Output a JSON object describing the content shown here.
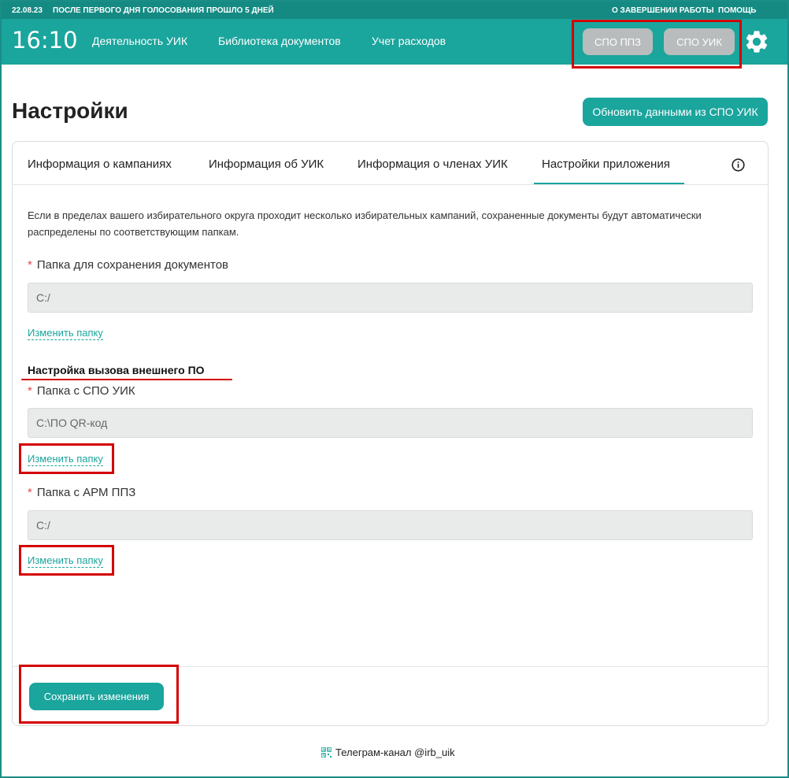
{
  "topbar": {
    "date": "22.08.23",
    "notice": "ПОСЛЕ ПЕРВОГО ДНЯ ГОЛОСОВАНИЯ ПРОШЛО 5 ДНЕЙ",
    "link_finish": "О ЗАВЕРШЕНИИ РАБОТЫ",
    "link_help": "ПОМОЩЬ"
  },
  "header": {
    "clock": "16:10",
    "nav": [
      "Деятельность УИК",
      "Библиотека документов",
      "Учет расходов"
    ],
    "pill_ppz": "СПО ППЗ",
    "pill_uik": "СПО УИК",
    "settings_icon": "gear-icon"
  },
  "page": {
    "title": "Настройки",
    "update_button": "Обновить данными из СПО УИК"
  },
  "tabs": [
    {
      "label": "Информация о кампаниях",
      "active": false
    },
    {
      "label": "Информация об УИК",
      "active": false
    },
    {
      "label": "Информация о членах УИК",
      "active": false
    },
    {
      "label": "Настройки приложения",
      "active": true
    }
  ],
  "settings": {
    "description": "Если в пределах вашего избирательного округа проходит несколько избирательных кампаний, сохраненные документы будут автоматически распределены по соответствующим папкам.",
    "docs_folder_label": "Папка для сохранения документов",
    "docs_folder_value": "C:/",
    "change_folder": "Изменить папку",
    "external_section_title": "Настройка вызова внешнего ПО",
    "spo_uik_label": "Папка с СПО УИК",
    "spo_uik_value": "C:\\ПО QR-код",
    "arm_ppz_label": "Папка с АРМ ППЗ",
    "arm_ppz_value": "C:/",
    "required_mark": "*"
  },
  "footer": {
    "save_button": "Сохранить изменения",
    "telegram": "Телеграм-канал @irb_uik"
  },
  "colors": {
    "accent": "#1aa59d",
    "topbar": "#148a83",
    "annotation": "#d40000",
    "pill_disabled": "#b9bcbc"
  }
}
